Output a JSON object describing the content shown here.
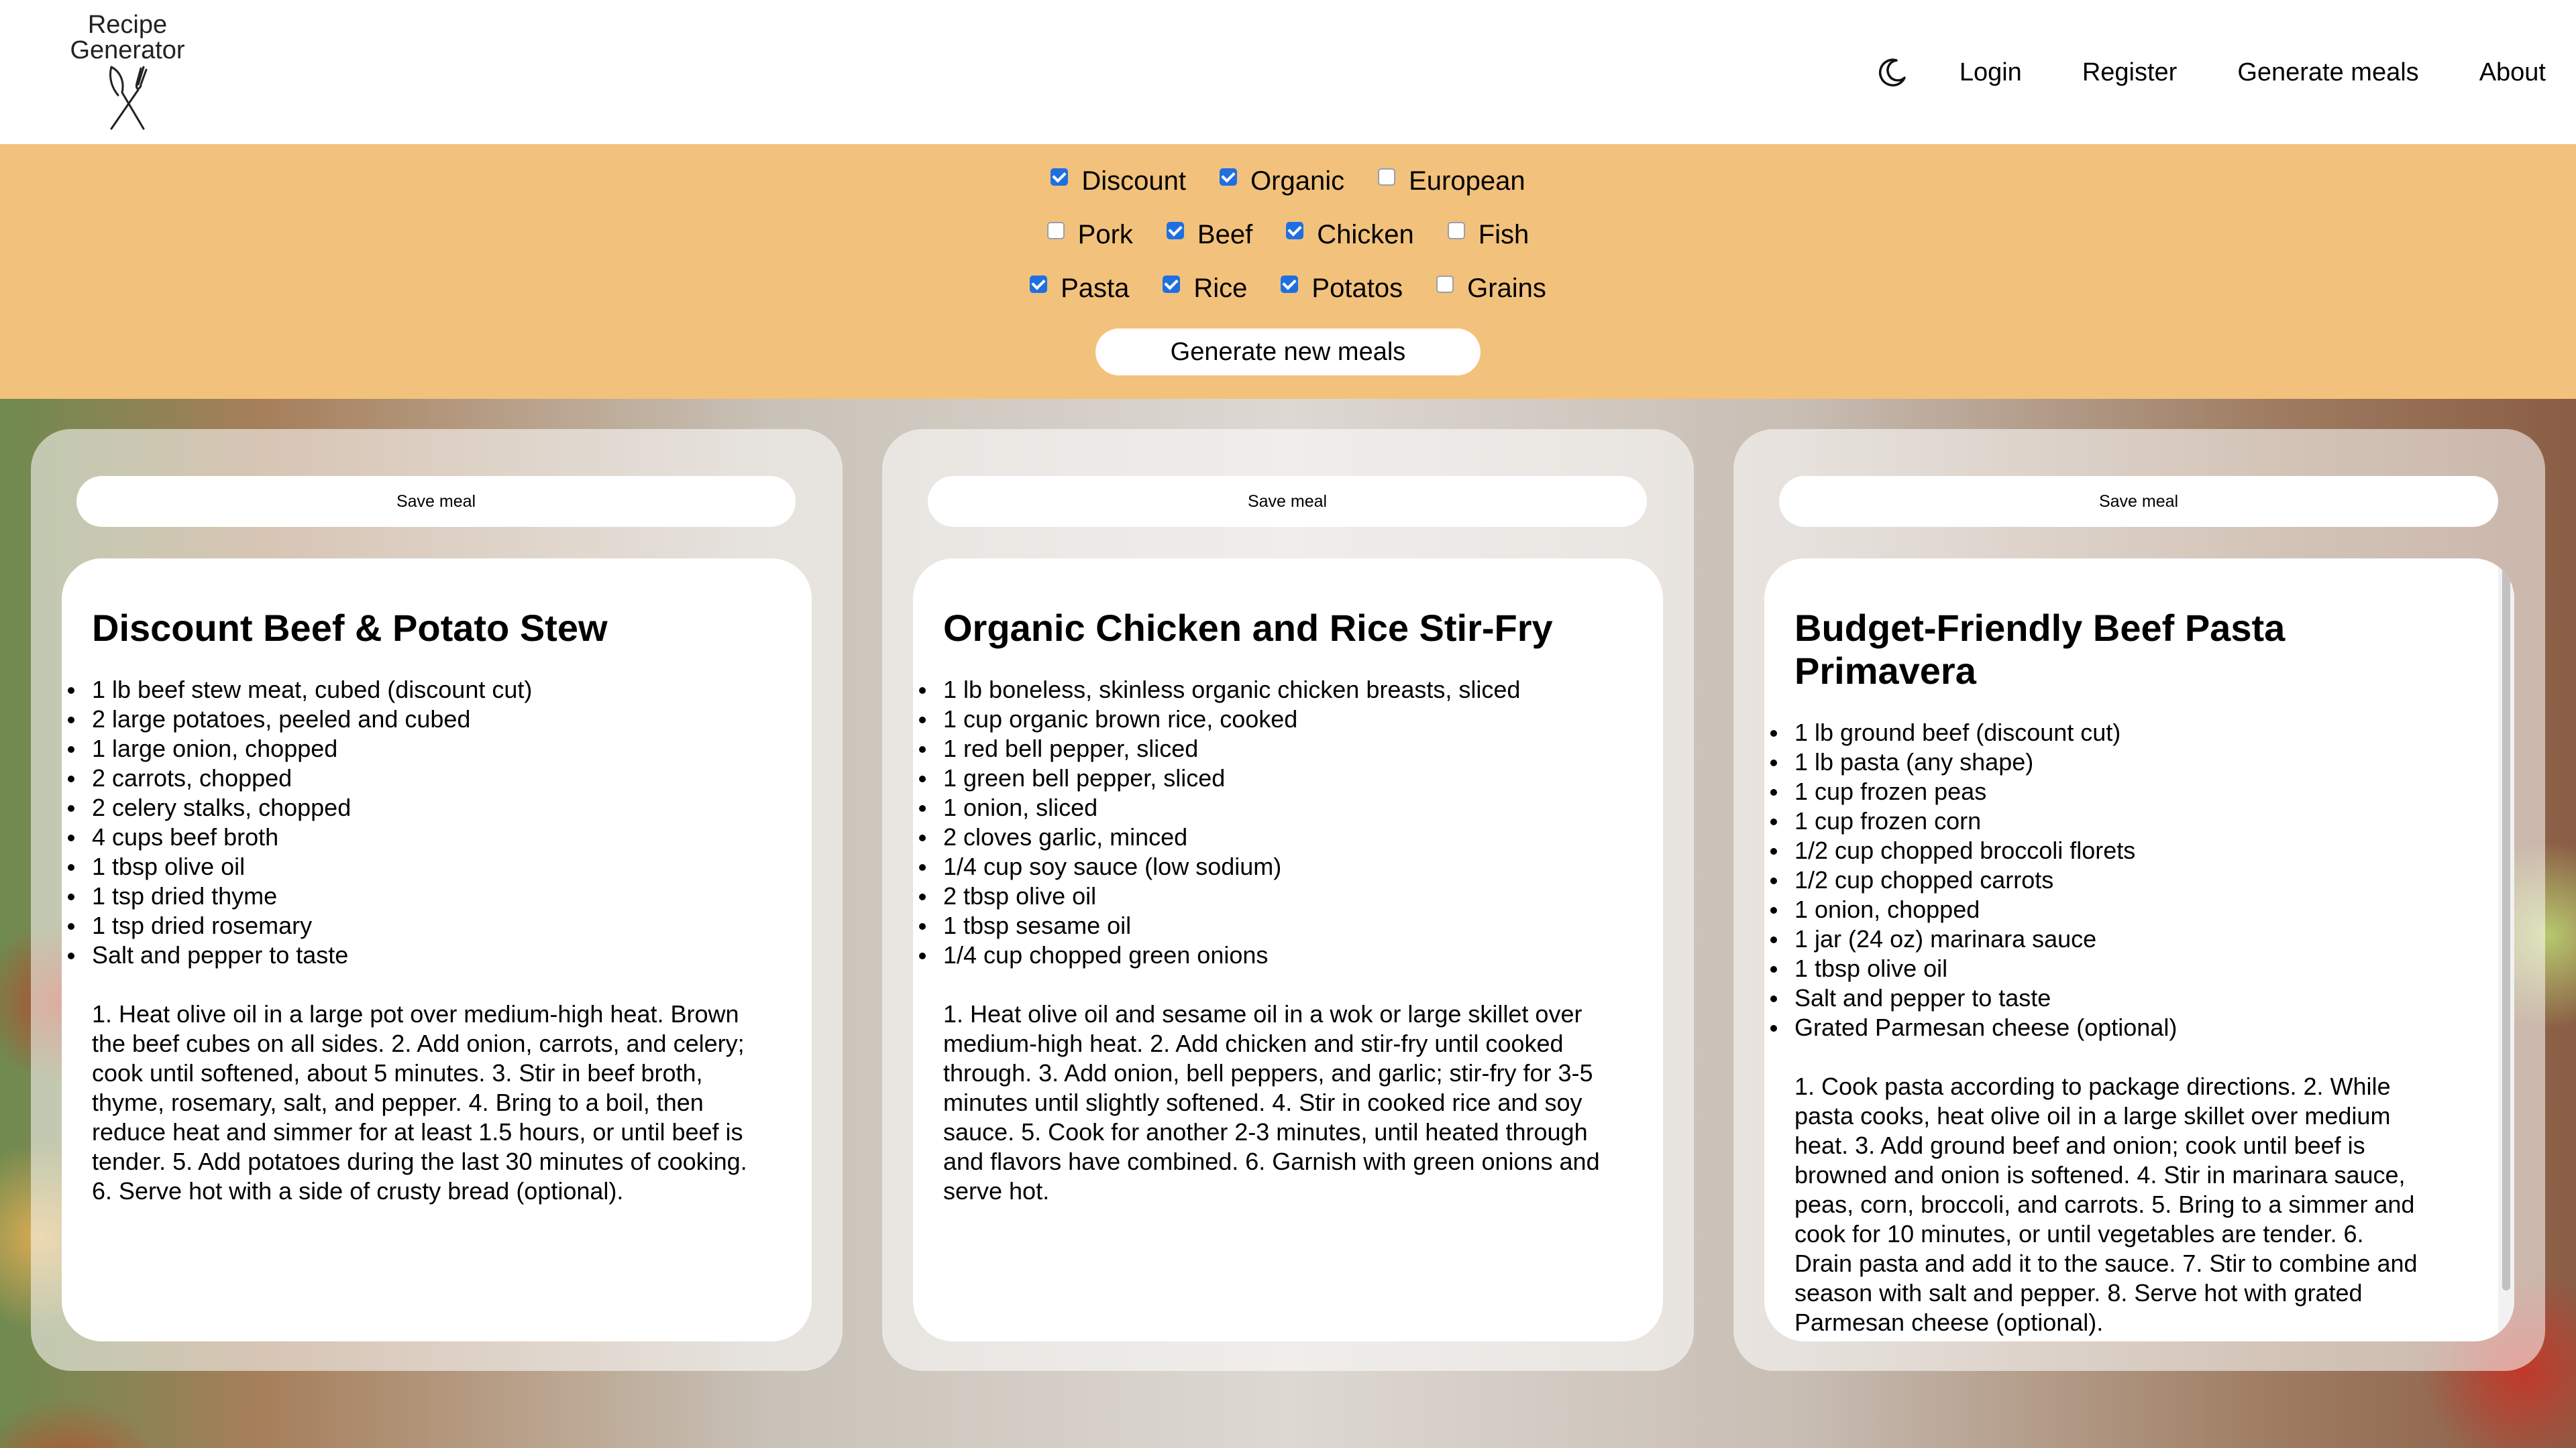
{
  "header": {
    "logo_line1": "Recipe",
    "logo_line2": "Generator",
    "logo_icon": "fork-knife-icon",
    "theme_icon": "moon-icon",
    "nav": {
      "login": "Login",
      "register": "Register",
      "generate_meals": "Generate meals",
      "about": "About"
    }
  },
  "filters": {
    "row1": [
      {
        "label": "Discount",
        "checked": true
      },
      {
        "label": "Organic",
        "checked": true
      },
      {
        "label": "European",
        "checked": false
      }
    ],
    "row2": [
      {
        "label": "Pork",
        "checked": false
      },
      {
        "label": "Beef",
        "checked": true
      },
      {
        "label": "Chicken",
        "checked": true
      },
      {
        "label": "Fish",
        "checked": false
      }
    ],
    "row3": [
      {
        "label": "Pasta",
        "checked": true
      },
      {
        "label": "Rice",
        "checked": true
      },
      {
        "label": "Potatos",
        "checked": true
      },
      {
        "label": "Grains",
        "checked": false
      }
    ],
    "generate_label": "Generate new meals"
  },
  "colors": {
    "filter_band": "#f2c17c",
    "checkbox_checked": "#1f6fe0"
  },
  "meals": [
    {
      "save_label": "Save meal",
      "title": "Discount Beef & Potato Stew",
      "ingredients": [
        "1 lb beef stew meat, cubed (discount cut)",
        "2 large potatoes, peeled and cubed",
        "1 large onion, chopped",
        "2 carrots, chopped",
        "2 celery stalks, chopped",
        "4 cups beef broth",
        "1 tbsp olive oil",
        "1 tsp dried thyme",
        "1 tsp dried rosemary",
        "Salt and pepper to taste"
      ],
      "instructions": "1. Heat olive oil in a large pot over medium-high heat. Brown the beef cubes on all sides. 2. Add onion, carrots, and celery; cook until softened, about 5 minutes. 3. Stir in beef broth, thyme, rosemary, salt, and pepper. 4. Bring to a boil, then reduce heat and simmer for at least 1.5 hours, or until beef is tender. 5. Add potatoes during the last 30 minutes of cooking. 6. Serve hot with a side of crusty bread (optional)."
    },
    {
      "save_label": "Save meal",
      "title": "Organic Chicken and Rice Stir-Fry",
      "ingredients": [
        "1 lb boneless, skinless organic chicken breasts, sliced",
        "1 cup organic brown rice, cooked",
        "1 red bell pepper, sliced",
        "1 green bell pepper, sliced",
        "1 onion, sliced",
        "2 cloves garlic, minced",
        "1/4 cup soy sauce (low sodium)",
        "2 tbsp olive oil",
        "1 tbsp sesame oil",
        "1/4 cup chopped green onions"
      ],
      "instructions": "1. Heat olive oil and sesame oil in a wok or large skillet over medium-high heat. 2. Add chicken and stir-fry until cooked through. 3. Add onion, bell peppers, and garlic; stir-fry for 3-5 minutes until slightly softened. 4. Stir in cooked rice and soy sauce. 5. Cook for another 2-3 minutes, until heated through and flavors have combined. 6. Garnish with green onions and serve hot."
    },
    {
      "save_label": "Save meal",
      "title": "Budget-Friendly Beef Pasta Primavera",
      "ingredients": [
        "1 lb ground beef (discount cut)",
        "1 lb pasta (any shape)",
        "1 cup frozen peas",
        "1 cup frozen corn",
        "1/2 cup chopped broccoli florets",
        "1/2 cup chopped carrots",
        "1 onion, chopped",
        "1 jar (24 oz) marinara sauce",
        "1 tbsp olive oil",
        "Salt and pepper to taste",
        "Grated Parmesan cheese (optional)"
      ],
      "instructions": "1. Cook pasta according to package directions. 2. While pasta cooks, heat olive oil in a large skillet over medium heat. 3. Add ground beef and onion; cook until beef is browned and onion is softened. 4. Stir in marinara sauce, peas, corn, broccoli, and carrots. 5. Bring to a simmer and cook for 10 minutes, or until vegetables are tender. 6. Drain pasta and add it to the sauce. 7. Stir to combine and season with salt and pepper. 8. Serve hot with grated Parmesan cheese (optional)."
    }
  ]
}
